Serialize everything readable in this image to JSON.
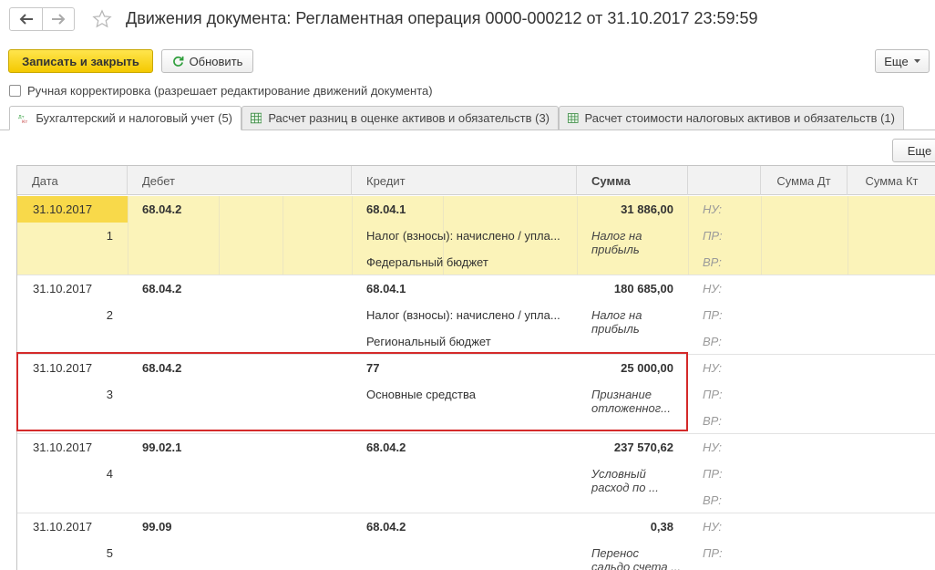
{
  "window": {
    "title": "Движения документа: Регламентная операция 0000-000212 от 31.10.2017 23:59:59"
  },
  "toolbar": {
    "save_close_label": "Записать и закрыть",
    "refresh_label": "Обновить",
    "more_label": "Еще"
  },
  "manual_edit": {
    "label": "Ручная корректировка (разрешает редактирование движений документа)",
    "checked": false
  },
  "tabs": [
    {
      "label": "Бухгалтерский и налоговый учет (5)",
      "icon": "dt-kt-icon",
      "active": true
    },
    {
      "label": "Расчет разниц в оценке активов и обязательств (3)",
      "icon": "table-icon",
      "active": false
    },
    {
      "label": "Расчет стоимости налоговых активов и обязательств (1)",
      "icon": "table-icon",
      "active": false
    }
  ],
  "grid": {
    "more_label": "Еще",
    "columns": {
      "date": "Дата",
      "debit": "Дебет",
      "credit": "Кредит",
      "amount": "Сумма",
      "amount_dt": "Сумма Дт",
      "amount_kt": "Сумма Кт"
    },
    "side_labels": [
      "НУ:",
      "ПР:",
      "ВР:"
    ],
    "rows": [
      {
        "date": "31.10.2017",
        "num": "1",
        "debit": "68.04.2",
        "credit": "68.04.1",
        "credit_sub1": "Налог (взносы): начислено / упла...",
        "credit_sub2": "Федеральный бюджет",
        "amount": "31 886,00",
        "content_line1": "Налог на",
        "content_line2": "прибыль",
        "selected": true
      },
      {
        "date": "31.10.2017",
        "num": "2",
        "debit": "68.04.2",
        "credit": "68.04.1",
        "credit_sub1": "Налог (взносы): начислено / упла...",
        "credit_sub2": "Региональный бюджет",
        "amount": "180 685,00",
        "content_line1": "Налог на",
        "content_line2": "прибыль",
        "selected": false
      },
      {
        "date": "31.10.2017",
        "num": "3",
        "debit": "68.04.2",
        "credit": "77",
        "credit_sub1": "Основные средства",
        "credit_sub2": "",
        "amount": "25 000,00",
        "content_line1": "Признание",
        "content_line2": "отложенног...",
        "selected": false
      },
      {
        "date": "31.10.2017",
        "num": "4",
        "debit": "99.02.1",
        "credit": "68.04.2",
        "credit_sub1": "",
        "credit_sub2": "",
        "amount": "237 570,62",
        "content_line1": "Условный",
        "content_line2": "расход по ...",
        "selected": false
      },
      {
        "date": "31.10.2017",
        "num": "5",
        "debit": "99.09",
        "credit": "68.04.2",
        "credit_sub1": "",
        "credit_sub2": "",
        "amount": "0,38",
        "content_line1": "Перенос",
        "content_line2": "сальдо счета ...",
        "selected": false
      }
    ]
  },
  "colors": {
    "primary_button": "#f4c900",
    "selected_row": "#fbf3b9",
    "selected_cell": "#f8d94a",
    "highlight_frame": "#d42a2a"
  }
}
